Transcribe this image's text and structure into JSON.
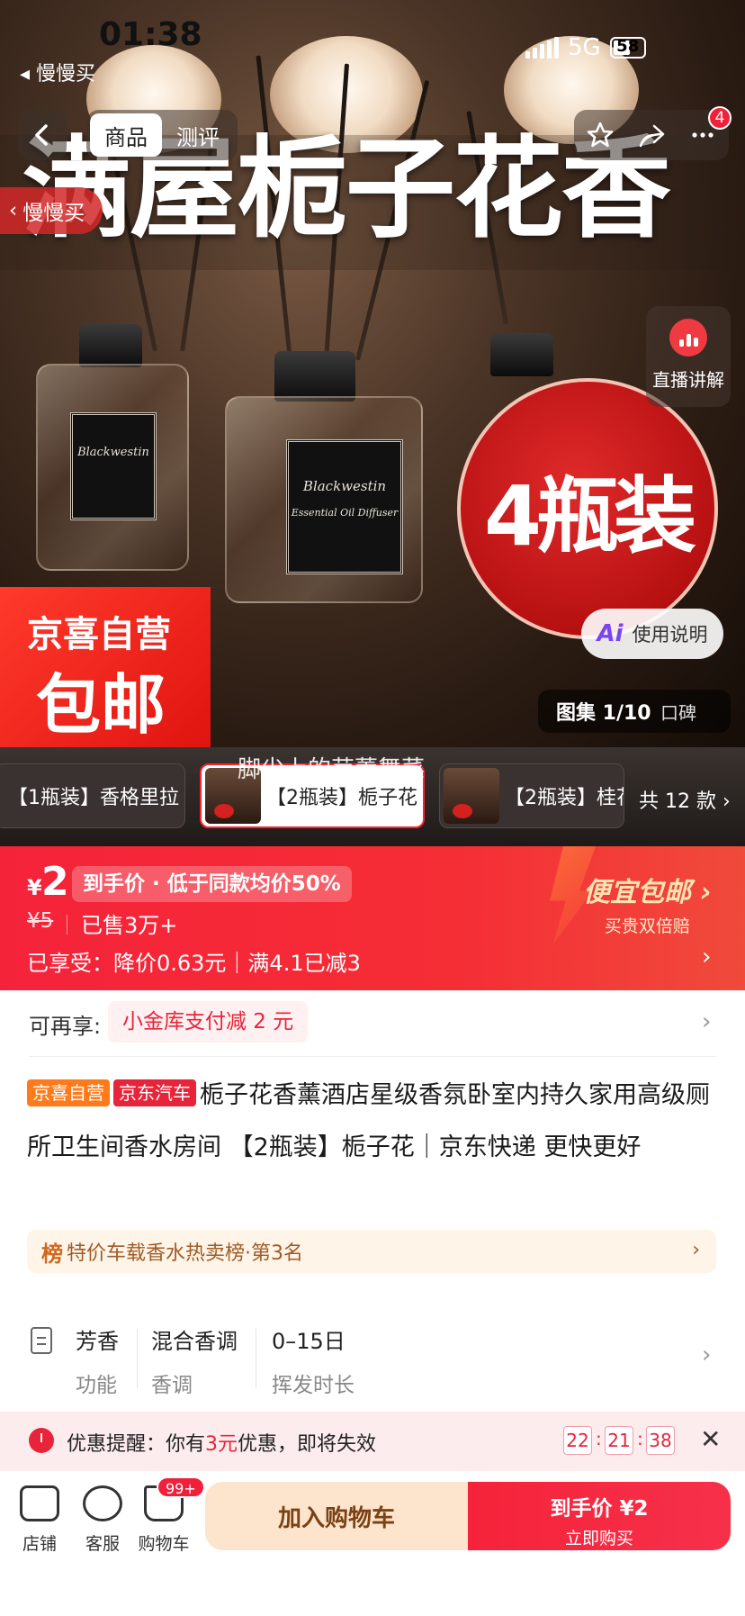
{
  "status": {
    "time": "01:38",
    "back_app": "◂ 慢慢买",
    "network": "5G",
    "battery": "58"
  },
  "nav": {
    "tabs": [
      {
        "label": "商品"
      },
      {
        "label": "测评"
      }
    ],
    "notification_count": "4",
    "side_back_label": "慢慢买"
  },
  "hero": {
    "title": "满屋栀子花香",
    "badge": "4瓶装",
    "self_operated_line1": "京喜自营",
    "self_operated_line2": "包邮",
    "bottle_brand": "Blackwestin",
    "bottle_sub": "Essential Oil Diffuser",
    "live_label": "直播讲解",
    "manual_label": "使用说明",
    "manual_ai": "Ai",
    "gallery_count": "图集 1/10",
    "gallery_review": "口碑"
  },
  "variants": {
    "items": [
      {
        "label": "【1瓶装】香格里拉"
      },
      {
        "label": "【2瓶装】栀子花"
      },
      {
        "label": "【2瓶装】桂花"
      }
    ],
    "more": "共 12 款",
    "floating_text": "脚尖上的芭蕾舞菜"
  },
  "price": {
    "currency": "¥",
    "amount": "2",
    "tag": "到手价 · 低于同款均价50%",
    "original": "¥5",
    "sold": "已售3万+",
    "enjoyed": "已享受：降价0.63元｜满4.1已减3",
    "promo_title": "便宜包邮 ›",
    "promo_sub": "买贵双倍赔"
  },
  "coupon": {
    "label": "可再享:",
    "offer": "小金库支付减 2 元"
  },
  "product": {
    "tag1": "京喜自营",
    "tag2": "京东汽车",
    "title": "栀子花香薰酒店星级香氛卧室内持久家用高级厕所卫生间香水房间 【2瓶装】栀子花｜京东快递 更快更好",
    "rank_icon": "榜",
    "rank": "特价车载香水热卖榜·第3名"
  },
  "specs": [
    {
      "value": "芳香",
      "key": "功能"
    },
    {
      "value": "混合香调",
      "key": "香调"
    },
    {
      "value": "0–15日",
      "key": "挥发时长"
    }
  ],
  "reminder": {
    "prefix": "优惠提醒：你有",
    "amount": "3元",
    "suffix": "优惠，即将失效",
    "h": "22",
    "m": "21",
    "s": "38"
  },
  "bottom": {
    "shop": "店铺",
    "service": "客服",
    "cart": "购物车",
    "cart_badge": "99+",
    "add_cart": "加入购物车",
    "buy_price": "到手价 ¥2",
    "buy_now": "立即购买"
  },
  "colors": {
    "accent": "#f5233a",
    "promo": "#ffe3b0"
  }
}
